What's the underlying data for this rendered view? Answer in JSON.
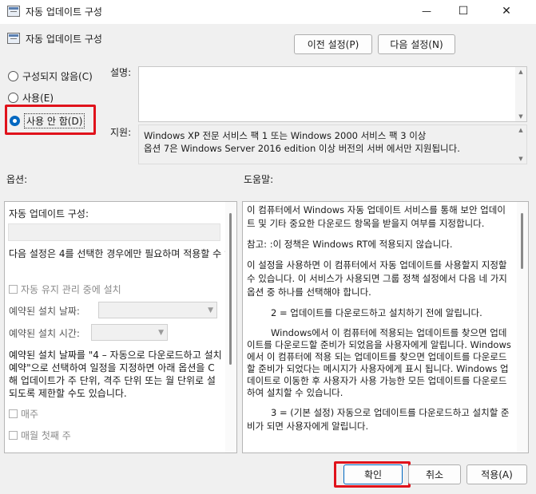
{
  "window": {
    "title": "자동 업데이트 구성",
    "icon": "policy-settings-icon",
    "minimize_glyph": "—",
    "maximize_glyph": "☐",
    "close_glyph": "✕"
  },
  "header": {
    "title": "자동 업데이트 구성",
    "prev_button": "이전 설정(P)",
    "next_button": "다음 설정(N)"
  },
  "state": {
    "options": [
      {
        "label": "구성되지 않음(C)",
        "selected": false
      },
      {
        "label": "사용(E)",
        "selected": false
      },
      {
        "label": "사용 안 함(D)",
        "selected": true
      }
    ]
  },
  "comment": {
    "label": "설명:",
    "value": ""
  },
  "supported": {
    "label": "지원:",
    "text": "Windows XP 전문 서비스 팩 1 또는 Windows 2000 서비스 팩 3 이상\n옵션 7은 Windows Server 2016 edition 이상 버전의 서버 에서만 지원됩니다."
  },
  "options_panel": {
    "label": "옵션:",
    "title": "자동 업데이트 구성:",
    "description": "다음 설정은 4를 선택한 경우에만 필요하며 적용할 수 있습니다.",
    "maintenance_checkbox": "자동 유지 관리 중에 설치",
    "install_day_label": "예약된 설치 날짜:",
    "install_time_label": "예약된 설치 시간:",
    "long_text": "예약된 설치 날짜를 \"4 – 자동으로 다운로드하고 설치 예약\"으로 선택하여 일정을 지정하면 아래 옵션을 C 해 업데이트가 주 단위, 격주 단위 또는 월 단위로 설 되도록 제한할 수도 있습니다.",
    "weekly_checkbox": "매주",
    "first_week_checkbox": "매월 첫째 주"
  },
  "help_panel": {
    "label": "도움말:",
    "paragraphs": [
      "이 컴퓨터에서 Windows 자동 업데이트 서비스를 통해 보안 업데이트 및 기타 중요한 다운로드 항목을 받을지 여부를 지정합니다.",
      "참고: :이 정책은 Windows RT에 적용되지 않습니다.",
      "이 설정을 사용하면 이 컴퓨터에서 자동 업데이트를 사용할지 지정할 수 있습니다. 이 서비스가 사용되면 그룹 정책 설정에서 다음 네 가지 옵션 중 하나를 선택해야 합니다.",
      "2 = 업데이트를 다운로드하고 설치하기 전에 알립니다.",
      "Windows에서 이 컴퓨터에 적용되는 업데이트를 찾으면 업데이트를 다운로드할 준비가 되었음을 사용자에게 알립니다. Windows에서 이 컴퓨터에 적용 되는 업데이트를 찾으면 업데이트를 다운로드할 준비가 되었다는 메시지가 사용자에게 표시 됩니다. Windows 업데이트로 이동한 후 사용자가 사용 가능한 모든 업데이트를 다운로드하여 설치할 수 있습니다.",
      "3 = (기본 설정) 자동으로 업데이트를 다운로드하고 설치할 준비가 되면 사용자에게 알립니다."
    ]
  },
  "footer": {
    "ok_button": "확인",
    "cancel_button": "취소",
    "apply_button": "적용(A)"
  },
  "colors": {
    "highlight": "#e0121b",
    "accent": "#0067c0"
  }
}
